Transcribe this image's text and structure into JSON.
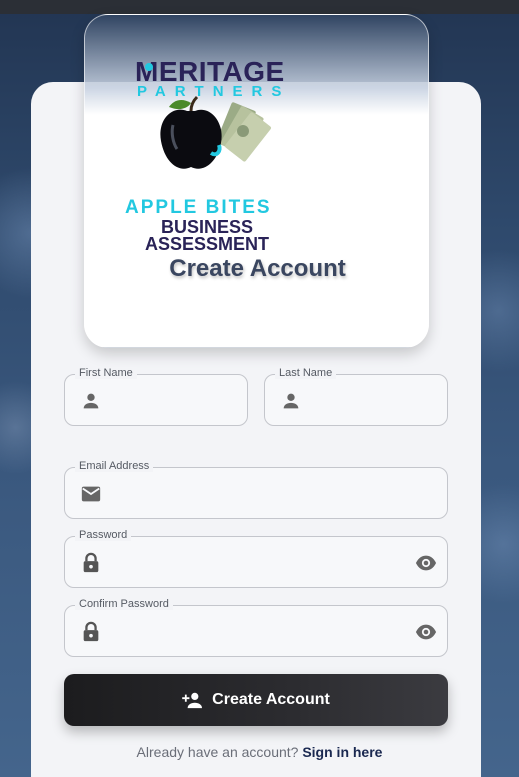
{
  "logo": {
    "brand_line1": "MERITAGE",
    "brand_line2": "PARTNERS",
    "product_line1": "APPLE BITES",
    "product_line2": "BUSINESS",
    "product_line3": "ASSESSMENT"
  },
  "form": {
    "title": "Create Account",
    "first_name": {
      "label": "First Name",
      "value": ""
    },
    "last_name": {
      "label": "Last Name",
      "value": ""
    },
    "email": {
      "label": "Email Address",
      "value": ""
    },
    "password": {
      "label": "Password",
      "value": ""
    },
    "confirm_password": {
      "label": "Confirm Password",
      "value": ""
    },
    "submit_label": "Create Account",
    "signin_prompt": "Already have an account?",
    "signin_link": "Sign in here"
  },
  "icons": {
    "person": "person-icon",
    "email": "mail-icon",
    "lock": "lock-icon",
    "visibility": "eye-icon",
    "add_user": "person-add-icon"
  },
  "colors": {
    "brand_navy": "#2a2358",
    "brand_cyan": "#22c8e0",
    "title": "#3a4660",
    "button": "#1c1c1e"
  }
}
